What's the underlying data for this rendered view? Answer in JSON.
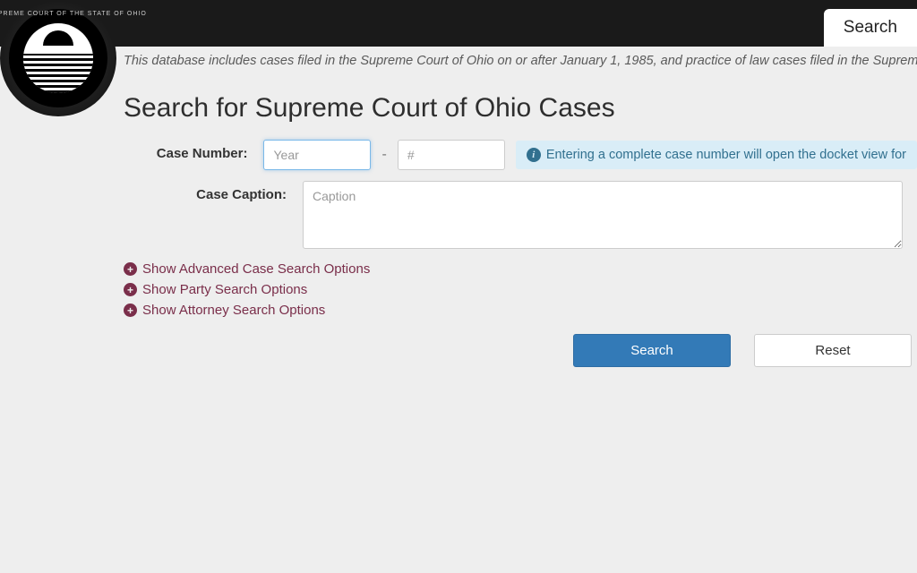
{
  "header": {
    "tab_label": "Search",
    "seal_text": "THE SUPREME COURT OF THE STATE OF OHIO"
  },
  "description": "This database includes cases filed in the Supreme Court of Ohio on or after January 1, 1985, and practice of law cases filed in the Supreme Court of Ohio on",
  "page_title": "Search for Supreme Court of Ohio Cases",
  "form": {
    "case_number_label": "Case Number:",
    "year_placeholder": "Year",
    "num_placeholder": "#",
    "dash": "-",
    "info_text": "Entering a complete case number will open the docket view for",
    "case_caption_label": "Case Caption:",
    "caption_placeholder": "Caption"
  },
  "toggles": {
    "advanced": "Show Advanced Case Search Options",
    "party": "Show Party Search Options",
    "attorney": "Show Attorney Search Options"
  },
  "buttons": {
    "search": "Search",
    "reset": "Reset"
  }
}
